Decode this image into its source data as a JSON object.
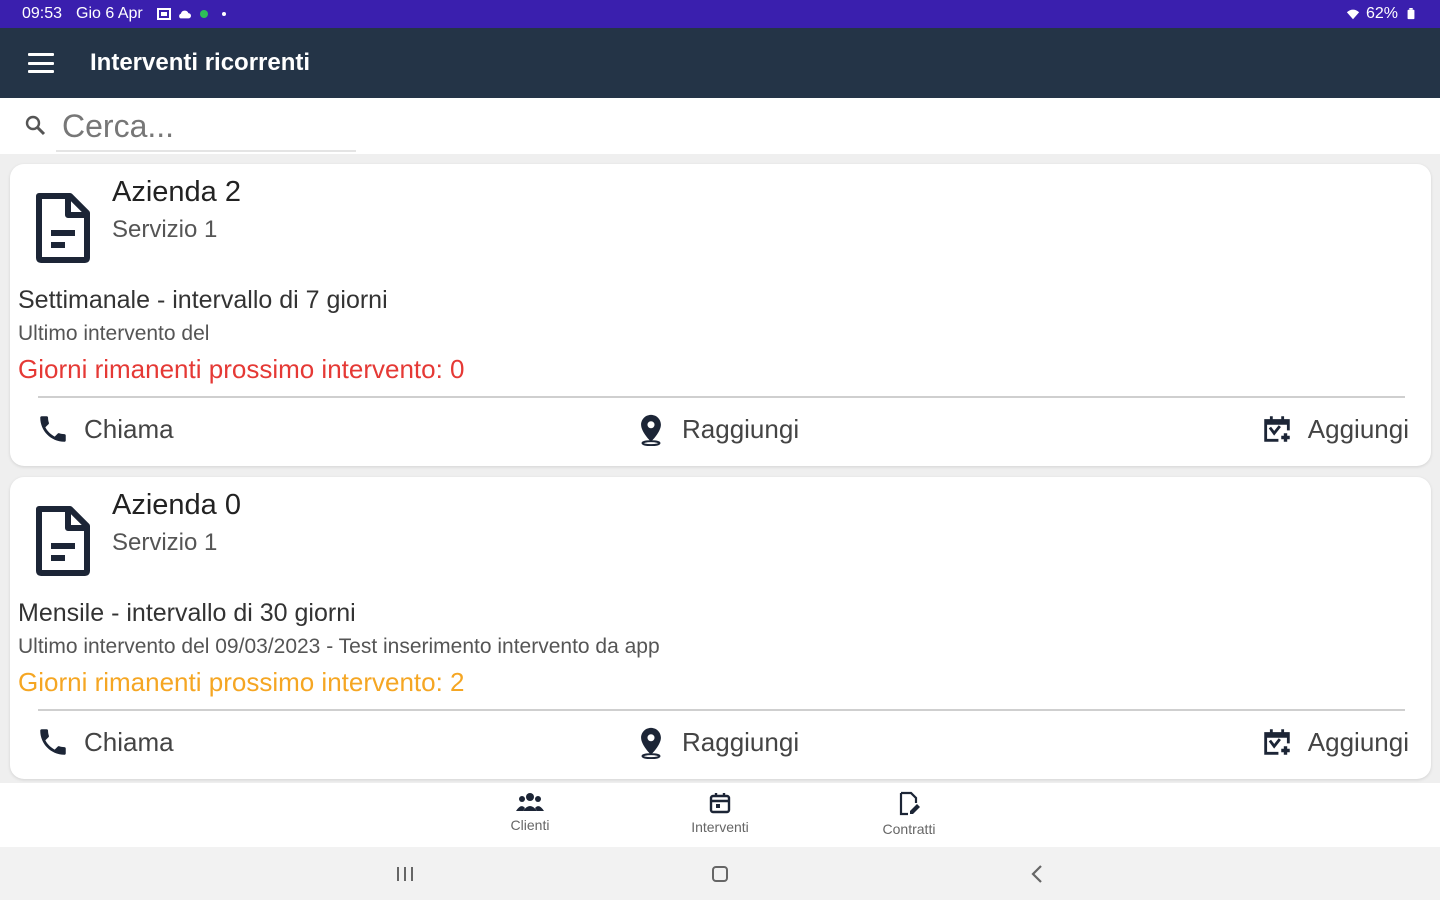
{
  "status_bar": {
    "time": "09:53",
    "date": "Gio 6 Apr",
    "battery": "62%"
  },
  "app_bar": {
    "title": "Interventi ricorrenti"
  },
  "search": {
    "placeholder": "Cerca..."
  },
  "cards": [
    {
      "company": "Azienda 2",
      "service": "Servizio 1",
      "frequency": "Settimanale - intervallo di 7 giorni",
      "last_intervention": "Ultimo intervento del",
      "remaining": "Giorni rimanenti prossimo intervento: 0",
      "remaining_color": "#e53935",
      "actions": {
        "call": "Chiama",
        "reach": "Raggiungi",
        "add": "Aggiungi"
      }
    },
    {
      "company": "Azienda 0",
      "service": "Servizio 1",
      "frequency": "Mensile - intervallo di 30 giorni",
      "last_intervention": "Ultimo intervento del 09/03/2023 - Test inserimento intervento da app",
      "remaining": "Giorni rimanenti prossimo intervento: 2",
      "remaining_color": "#f5a623",
      "actions": {
        "call": "Chiama",
        "reach": "Raggiungi",
        "add": "Aggiungi"
      }
    }
  ],
  "bottom_nav": {
    "items": [
      {
        "label": "Clienti",
        "icon": "people-icon"
      },
      {
        "label": "Interventi",
        "icon": "calendar-icon"
      },
      {
        "label": "Contratti",
        "icon": "contract-edit-icon"
      }
    ]
  },
  "colors": {
    "status_bar": "#3a1fae",
    "app_bar": "#243447",
    "icon_dark": "#1c2536",
    "danger": "#e53935",
    "warning": "#f5a623"
  }
}
